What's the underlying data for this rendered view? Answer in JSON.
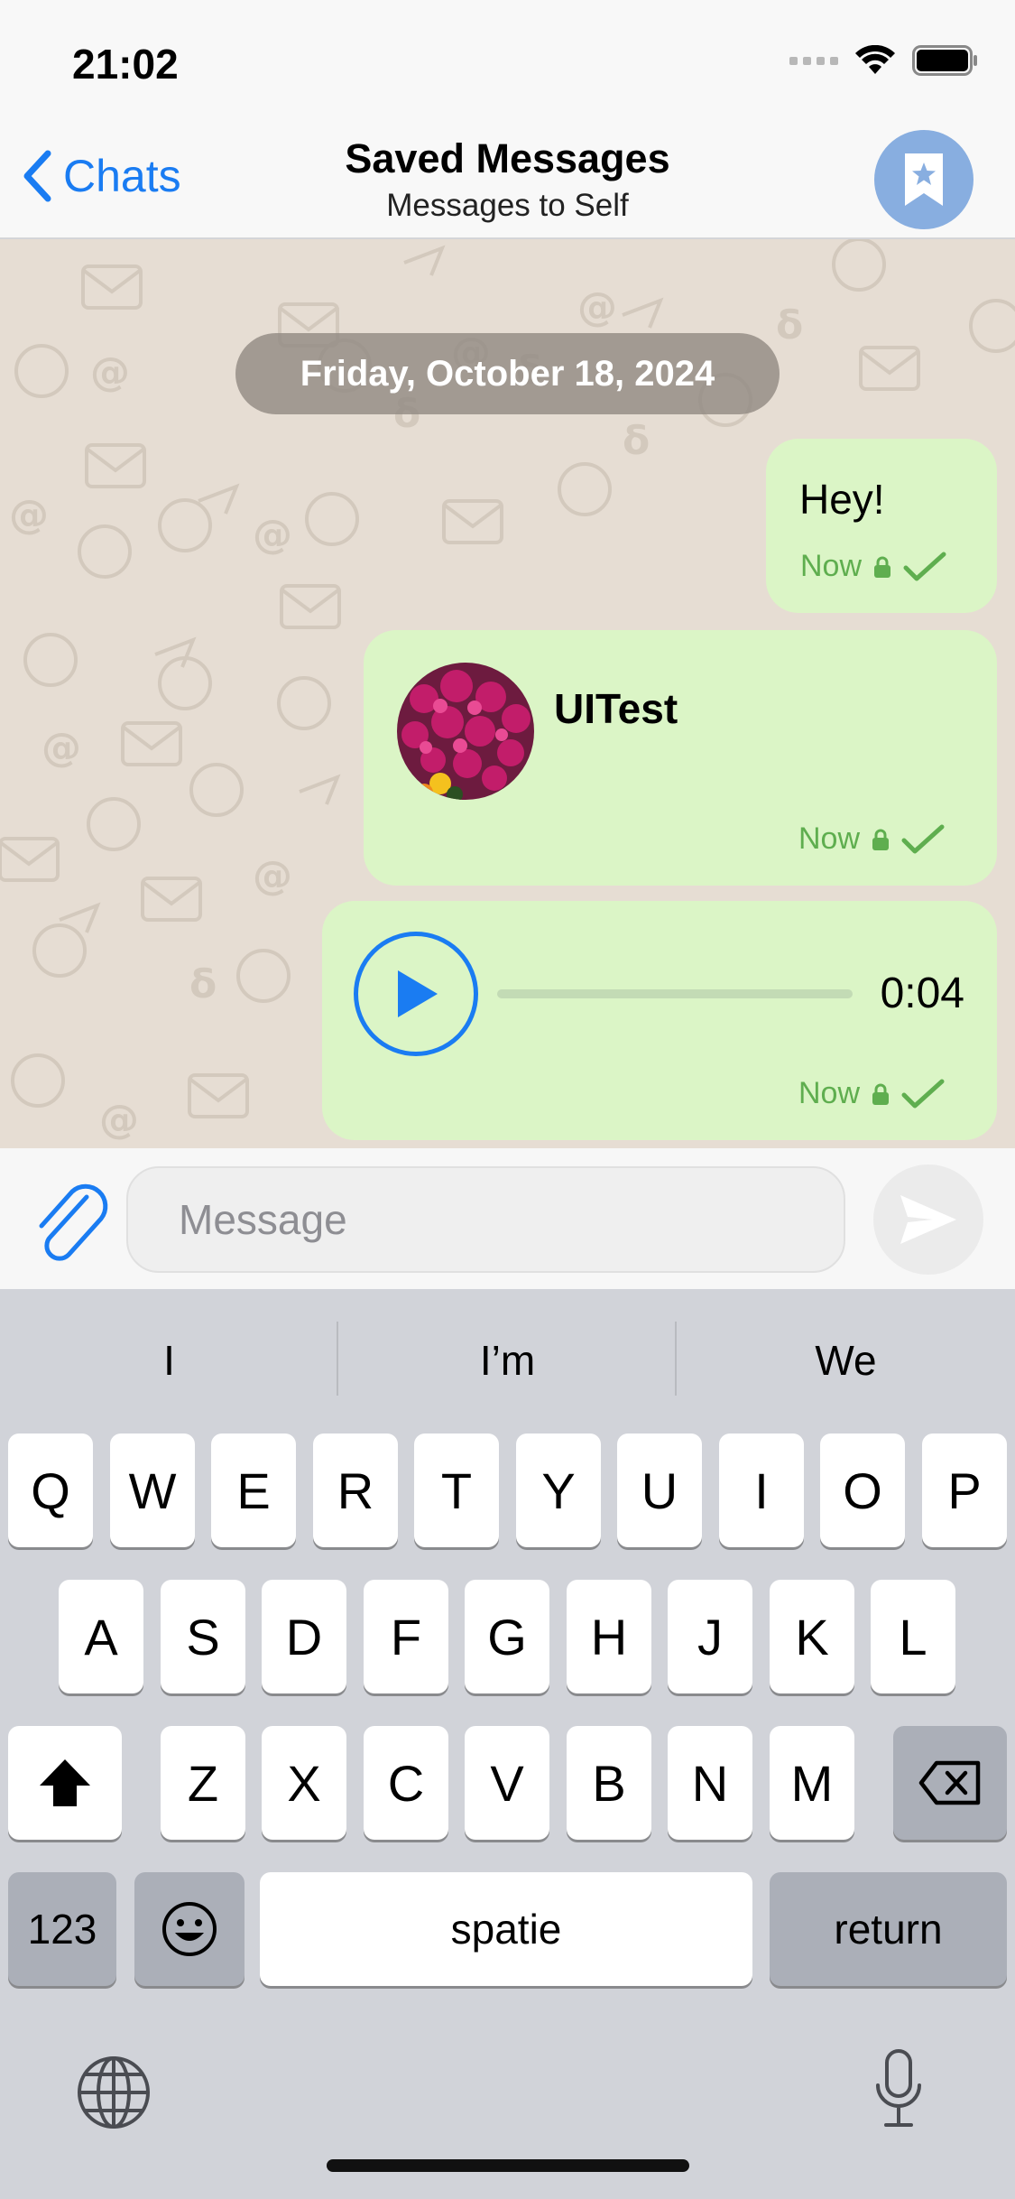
{
  "status_bar": {
    "time": "21:02"
  },
  "nav": {
    "back_label": "Chats",
    "title": "Saved Messages",
    "subtitle": "Messages to Self"
  },
  "chat": {
    "date_label": "Friday, October 18, 2024",
    "messages": [
      {
        "type": "text",
        "text": "Hey!",
        "time": "Now"
      },
      {
        "type": "contact",
        "name": "UITest",
        "time": "Now"
      },
      {
        "type": "voice",
        "duration": "0:04",
        "time": "Now"
      }
    ]
  },
  "composer": {
    "placeholder": "Message"
  },
  "keyboard": {
    "suggestions": [
      "I",
      "I’m",
      "We"
    ],
    "row1": [
      "Q",
      "W",
      "E",
      "R",
      "T",
      "Y",
      "U",
      "I",
      "O",
      "P"
    ],
    "row2": [
      "A",
      "S",
      "D",
      "F",
      "G",
      "H",
      "J",
      "K",
      "L"
    ],
    "row3": [
      "Z",
      "X",
      "C",
      "V",
      "B",
      "N",
      "M"
    ],
    "numbers_label": "123",
    "space_label": "spatie",
    "return_label": "return"
  },
  "colors": {
    "accent": "#1a7cf2",
    "bubble": "#dbf5c6",
    "meta_green": "#5fae4f",
    "chat_bg": "#e6ddd3",
    "avatar": "#88aee0"
  }
}
